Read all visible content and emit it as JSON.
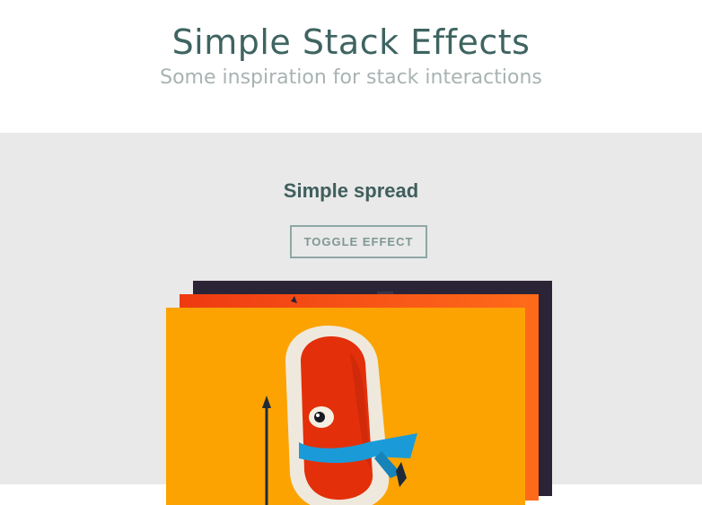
{
  "header": {
    "title": "Simple Stack Effects",
    "subtitle": "Some inspiration for stack interactions"
  },
  "demo": {
    "section_title": "Simple spread",
    "toggle_label": "TOGGLE EFFECT"
  },
  "colors": {
    "header_bg": "#ffffff",
    "content_bg": "#e9e9e9",
    "title_color": "#3e6461",
    "subtitle_color": "#a8b3b2",
    "card_back": "#2b2436",
    "card_mid": "#ef3c12",
    "card_front": "#fca301"
  }
}
